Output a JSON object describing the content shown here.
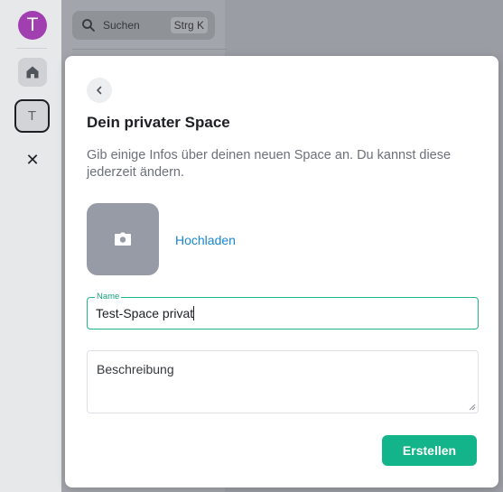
{
  "rail": {
    "avatar_letter": "T",
    "space_letter": "T",
    "close_symbol": "✕"
  },
  "background": {
    "search_placeholder": "Suchen",
    "search_shortcut": "Strg K"
  },
  "modal": {
    "title": "Dein privater Space",
    "subtitle": "Gib einige Infos über deinen neuen Space an. Du kannst diese jederzeit ändern.",
    "upload_label": "Hochladen",
    "name_label": "Name",
    "name_value": "Test-Space privat",
    "description_placeholder": "Beschreibung",
    "create_label": "Erstellen"
  },
  "colors": {
    "accent": "#14b48a",
    "avatar": "#a23fb0",
    "link": "#1a86d0"
  },
  "icons": [
    "home-icon",
    "close-icon",
    "search-icon",
    "back-chevron-icon",
    "camera-icon"
  ]
}
